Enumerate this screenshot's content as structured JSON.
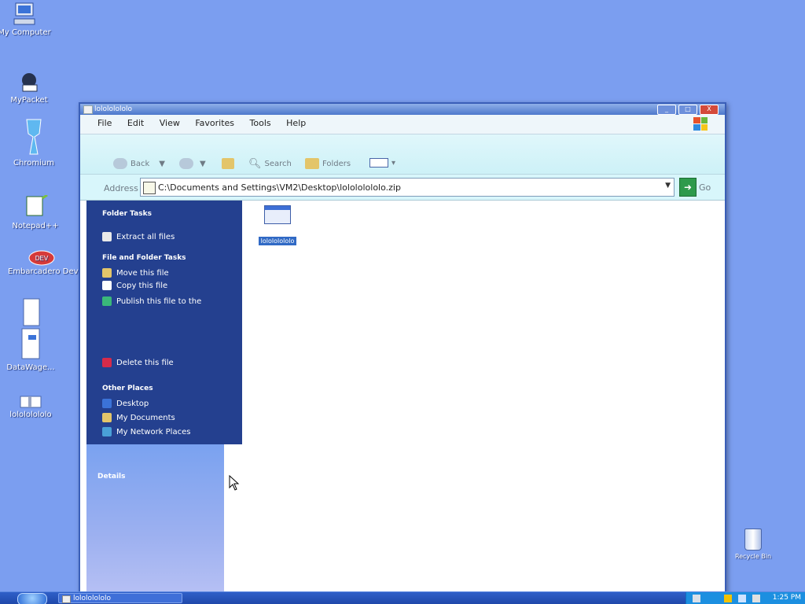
{
  "desktop": {
    "icons": [
      {
        "label": "My Computer"
      },
      {
        "label": "MyPacket"
      },
      {
        "label": "Chromium"
      },
      {
        "label": "Notepad++"
      },
      {
        "label": "Embarcadero Dev C++"
      },
      {
        "label": "DataWage..."
      },
      {
        "label": "lolololololo"
      }
    ],
    "recycle_bin": {
      "label": "Recycle Bin"
    }
  },
  "window": {
    "title": "lolololololo",
    "buttons": {
      "minimize": "_",
      "maximize": "□",
      "close": "X"
    },
    "menu": [
      "File",
      "Edit",
      "View",
      "Favorites",
      "Tools",
      "Help"
    ],
    "toolbar": {
      "back": "Back",
      "search": "Search",
      "folders": "Folders"
    },
    "address": {
      "label": "Address",
      "value": "C:\\Documents and Settings\\VM2\\Desktop\\lolololololo.zip",
      "go": "Go"
    },
    "task_pane": {
      "folder_tasks": {
        "header": "Folder Tasks",
        "items": [
          {
            "label": "Extract all files"
          }
        ]
      },
      "file_tasks": {
        "header": "File and Folder Tasks",
        "items": [
          {
            "label": "Move this file"
          },
          {
            "label": "Copy this file"
          },
          {
            "label": "Publish this file to the"
          },
          {
            "label": "Delete this file"
          }
        ]
      },
      "other_places": {
        "header": "Other Places",
        "items": [
          {
            "label": "Desktop"
          },
          {
            "label": "My Documents"
          },
          {
            "label": "My Network Places"
          }
        ]
      },
      "details": {
        "header": "Details"
      }
    },
    "files": [
      {
        "name": "lolololololo"
      }
    ]
  },
  "taskbar": {
    "task_button": "lolololololo",
    "clock": "1:25 PM"
  },
  "colors": {
    "desktop": "#7b9ef0",
    "taskpane": "#24408f",
    "taskbar": "#1e47a8",
    "selection": "#316ac5"
  }
}
